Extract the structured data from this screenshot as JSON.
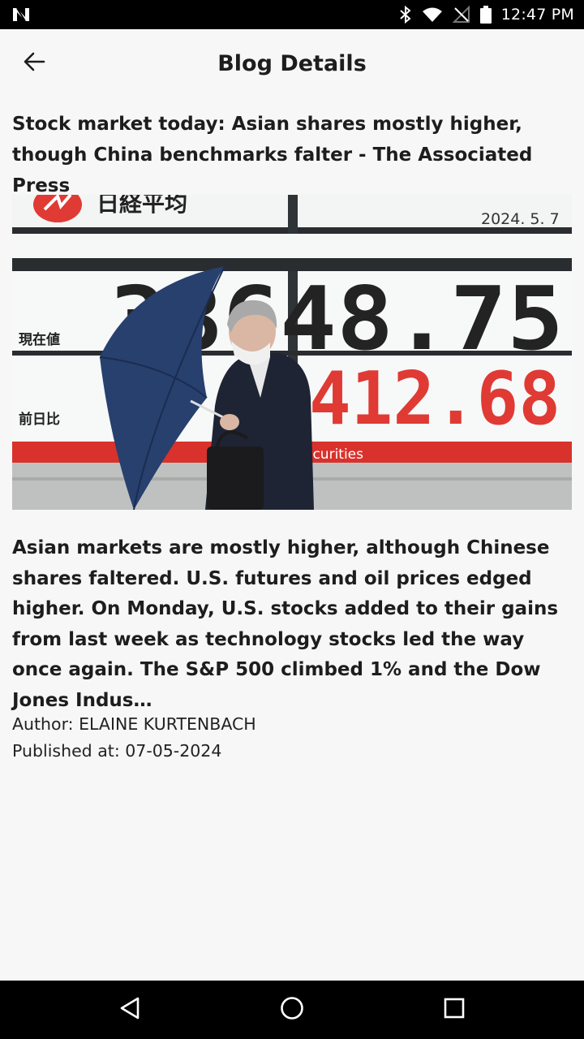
{
  "status_bar": {
    "time": "12:47 PM",
    "icons": [
      "notification-n-icon",
      "bluetooth-icon",
      "wifi-icon",
      "no-signal-icon",
      "battery-icon"
    ]
  },
  "app_bar": {
    "title": "Blog Details",
    "back_icon": "arrow-left-icon"
  },
  "article": {
    "title": "Stock market today: Asian shares mostly higher, though China benchmarks falter - The Associated Press",
    "image": {
      "date_text": "2024. 5. 7",
      "board_value_top": "38648.75",
      "board_value_bottom": "412.68",
      "label_current": "現在値",
      "label_prev": "前日比",
      "logo_text": "日経平均",
      "bank_text": "ecurities"
    },
    "body": "Asian markets are mostly higher, although Chinese shares faltered. U.S. futures and oil prices edged higher. On Monday, U.S. stocks added to their gains from last week as technology stocks led the way once again. The S&P 500 climbed 1% and the Dow Jones Indus…",
    "author_line": "Author: ELAINE KURTENBACH",
    "published_line": "Published at: 07-05-2024"
  },
  "nav_bar": {
    "icons": [
      "back-triangle-icon",
      "home-circle-icon",
      "recents-square-icon"
    ]
  },
  "colors": {
    "status_bar": "#000000",
    "background": "#f7f7f7",
    "text": "#1d1d1d",
    "ticker_red": "#e03a34",
    "umbrella_blue": "#27406e"
  }
}
